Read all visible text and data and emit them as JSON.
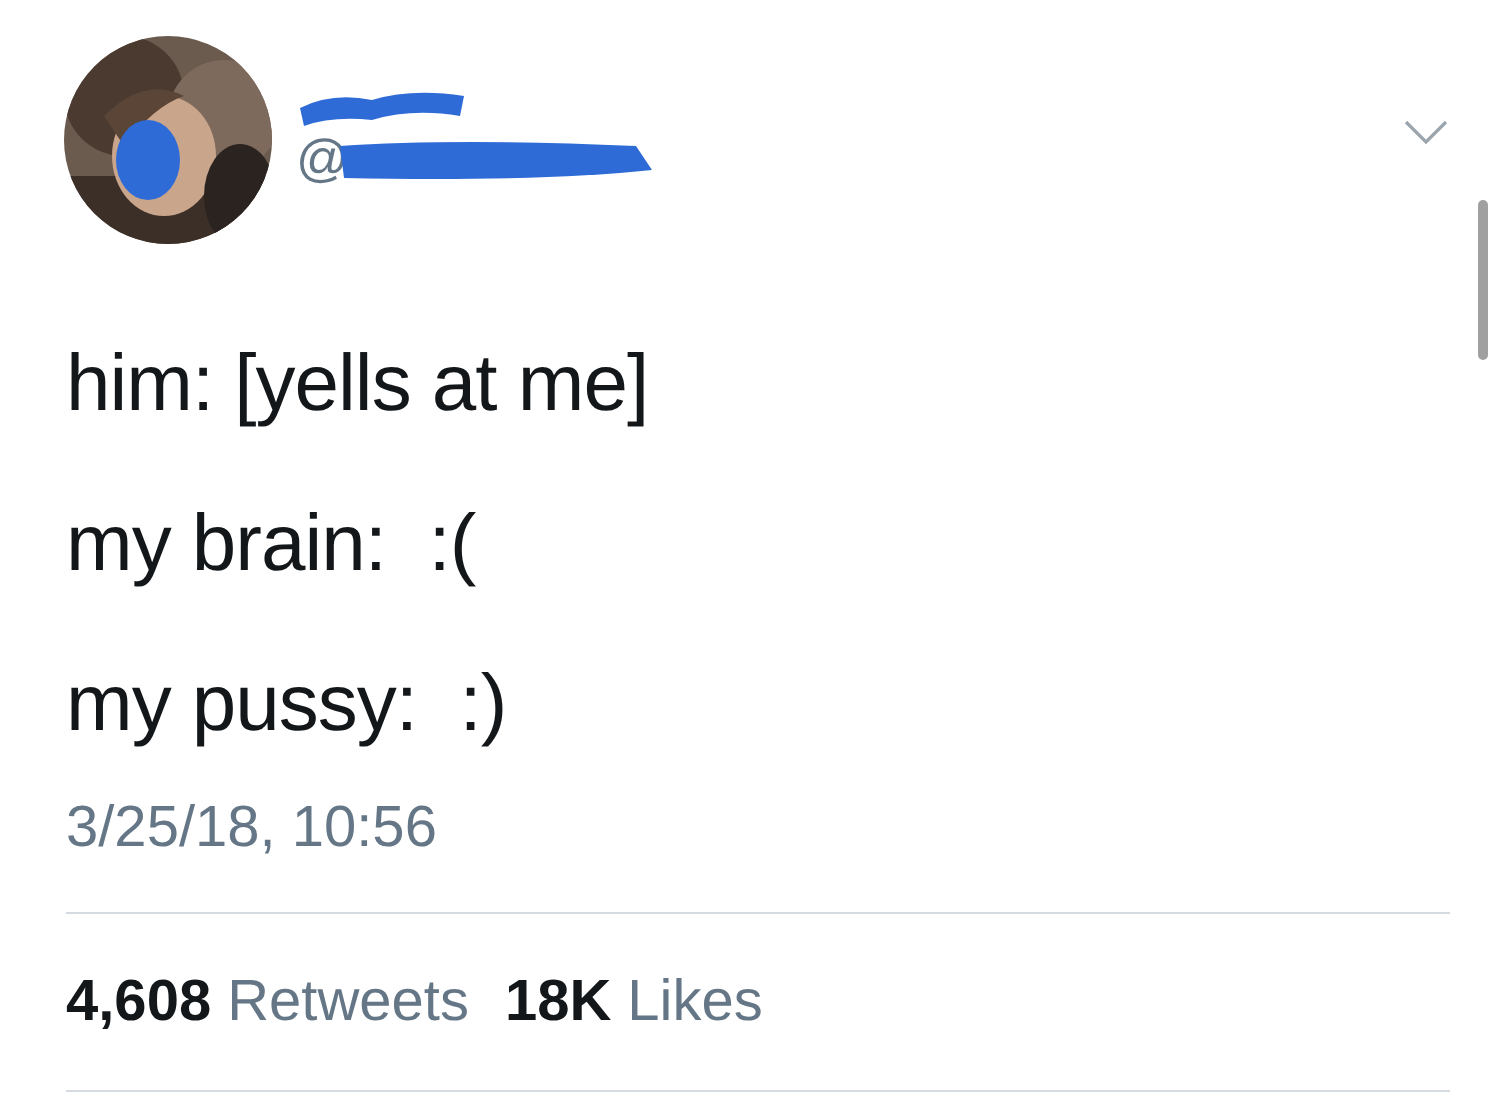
{
  "author": {
    "handle_prefix": "@"
  },
  "tweet": {
    "lines": [
      "him: [yells at me]",
      "my brain:  :(",
      "my pussy:  :)"
    ],
    "timestamp": "3/25/18, 10:56",
    "stats": [
      {
        "count": "4,608",
        "label": "Retweets"
      },
      {
        "count": "18K",
        "label": "Likes"
      }
    ]
  }
}
